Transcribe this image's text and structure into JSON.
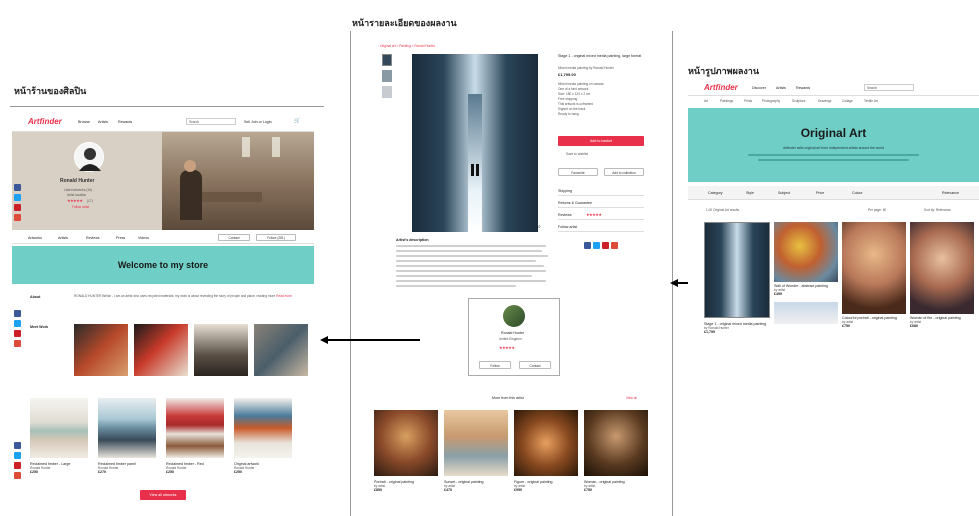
{
  "captions": {
    "artist_store": "หน้าร้านของศิลปิน",
    "artwork_detail": "หน้ารายละเอียดของผลงาน",
    "artwork_list": "หน้ารูปภาพผลงาน"
  },
  "brand": "Artfinder",
  "colors": {
    "brand": "#e8304a",
    "teal": "#6fcfc7",
    "beige": "#d8d0c4"
  },
  "store": {
    "nav": [
      "Browse",
      "Artists",
      "Rewards"
    ],
    "search_placeholder": "Search",
    "header_right": "Sell  Join or Login",
    "artist_name": "Ronald Hunter",
    "artist_meta": [
      "Listed artworks (16)",
      "Artist location"
    ],
    "rating_text": "(17)",
    "follow_label": "Follow artist",
    "tabs": [
      "Artworks",
      "Artists",
      "Reviews",
      "Press",
      "Videos"
    ],
    "contact_label": "Contact",
    "follow_btn": "Follow (281)",
    "welcome": "Welcome to my store",
    "about_label": "About",
    "about_text": "RONALD HUNTER British - I am an artist who uses recycled materials; my work is about revealing the story of people and place, reading more",
    "read_more": "Read more",
    "meet_label": "Meet Work",
    "products": [
      {
        "title": "Reclaimed timber - Large",
        "price": "£250",
        "meta": "Ronald Hunter"
      },
      {
        "title": "Reclaimed timber panel",
        "price": "£270",
        "meta": "Ronald Hunter"
      },
      {
        "title": "Reclaimed timber - Red",
        "price": "£250",
        "meta": "Ronald Hunter"
      },
      {
        "title": "Original artwork",
        "price": "£250",
        "meta": "Ronald Hunter"
      }
    ],
    "view_all": "View all artworks"
  },
  "detail": {
    "breadcrumb": "Original art > Painting > Ronald Hunter",
    "title": "Stage 1 - original mixed media painting, large format",
    "subtitle": "Mixed media painting by Ronald Hunter",
    "price": "£1,799.00",
    "features": [
      "Mixed media painting on canvas",
      "One of a kind artwork",
      "Size: 180 x 120 x 2 cm",
      "Free shipping",
      "This artwork is unframed",
      "Signed on the back",
      "Ready to hang"
    ],
    "add_to_basket": "Add to basket",
    "wishlist": "Save to wishlist",
    "favourite": "Favourite",
    "add_collection": "Add to collection",
    "accordion": [
      "Shipping",
      "Returns & Guarantee",
      "Reviews",
      "Follow artist"
    ],
    "statement_title": "Artist's description",
    "artist_card_name": "Ronald Hunter",
    "artist_card_loc": "United Kingdom",
    "card_follow": "Follow",
    "card_contact": "Contact",
    "more_label": "More from this artist",
    "view_all": "View all",
    "related": [
      {
        "title": "Portrait - original painting",
        "price": "£850",
        "meta": "by artist"
      },
      {
        "title": "Sunset - original painting",
        "price": "£470",
        "meta": "by artist"
      },
      {
        "title": "Figure - original painting",
        "price": "£950",
        "meta": "by artist"
      },
      {
        "title": "Woman - original painting",
        "price": "£750",
        "meta": "by artist"
      }
    ]
  },
  "list": {
    "nav": [
      "Discover",
      "Artists",
      "Rewards"
    ],
    "search_placeholder": "Search",
    "categories": [
      "Art",
      "Paintings",
      "Prints",
      "Photography",
      "Sculpture",
      "Drawings",
      "Collage",
      "Textile Art"
    ],
    "hero_title": "Original Art",
    "hero_text": "Artfinder sells original art from independent artists around the world",
    "filters": [
      "Category",
      "Style",
      "Subject",
      "Price",
      "Colour"
    ],
    "sort_label": "Relevance",
    "results": "1,00 Original Art results",
    "per_page": "Per page: 60",
    "sort_by": "Sort by: Relevance",
    "items": [
      {
        "title": "Stage 1 - original mixed media painting",
        "price": "£1,799",
        "meta": "by Ronald Hunter"
      },
      {
        "title": "Wall of Wonder - abstract painting",
        "price": "£499",
        "meta": "by artist"
      },
      {
        "title": "Colourful portrait - original painting",
        "price": "£750",
        "meta": "by artist"
      },
      {
        "title": "Woman of fire - original painting",
        "price": "£680",
        "meta": "by artist"
      }
    ]
  }
}
